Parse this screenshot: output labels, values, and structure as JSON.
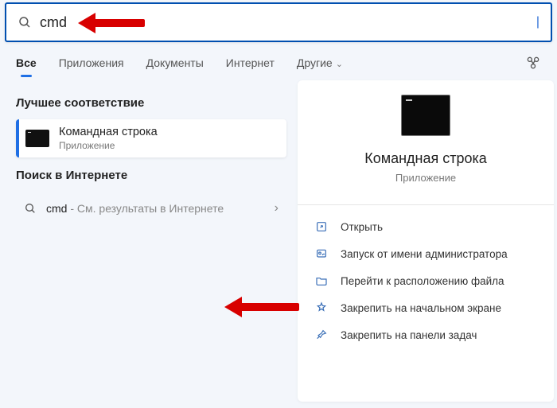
{
  "search": {
    "query": "cmd",
    "placeholder": ""
  },
  "tabs": {
    "all": "Все",
    "apps": "Приложения",
    "docs": "Документы",
    "internet": "Интернет",
    "other": "Другие"
  },
  "left": {
    "best_match_label": "Лучшее соответствие",
    "result": {
      "title": "Командная строка",
      "subtitle": "Приложение"
    },
    "web_search_label": "Поиск в Интернете",
    "web_item": {
      "query": "cmd",
      "suffix": " - См. результаты в Интернете"
    }
  },
  "preview": {
    "title": "Командная строка",
    "subtitle": "Приложение"
  },
  "actions": {
    "open": "Открыть",
    "run_admin": "Запуск от имени администратора",
    "open_location": "Перейти к расположению файла",
    "pin_start": "Закрепить на начальном экране",
    "pin_taskbar": "Закрепить на панели задач"
  }
}
